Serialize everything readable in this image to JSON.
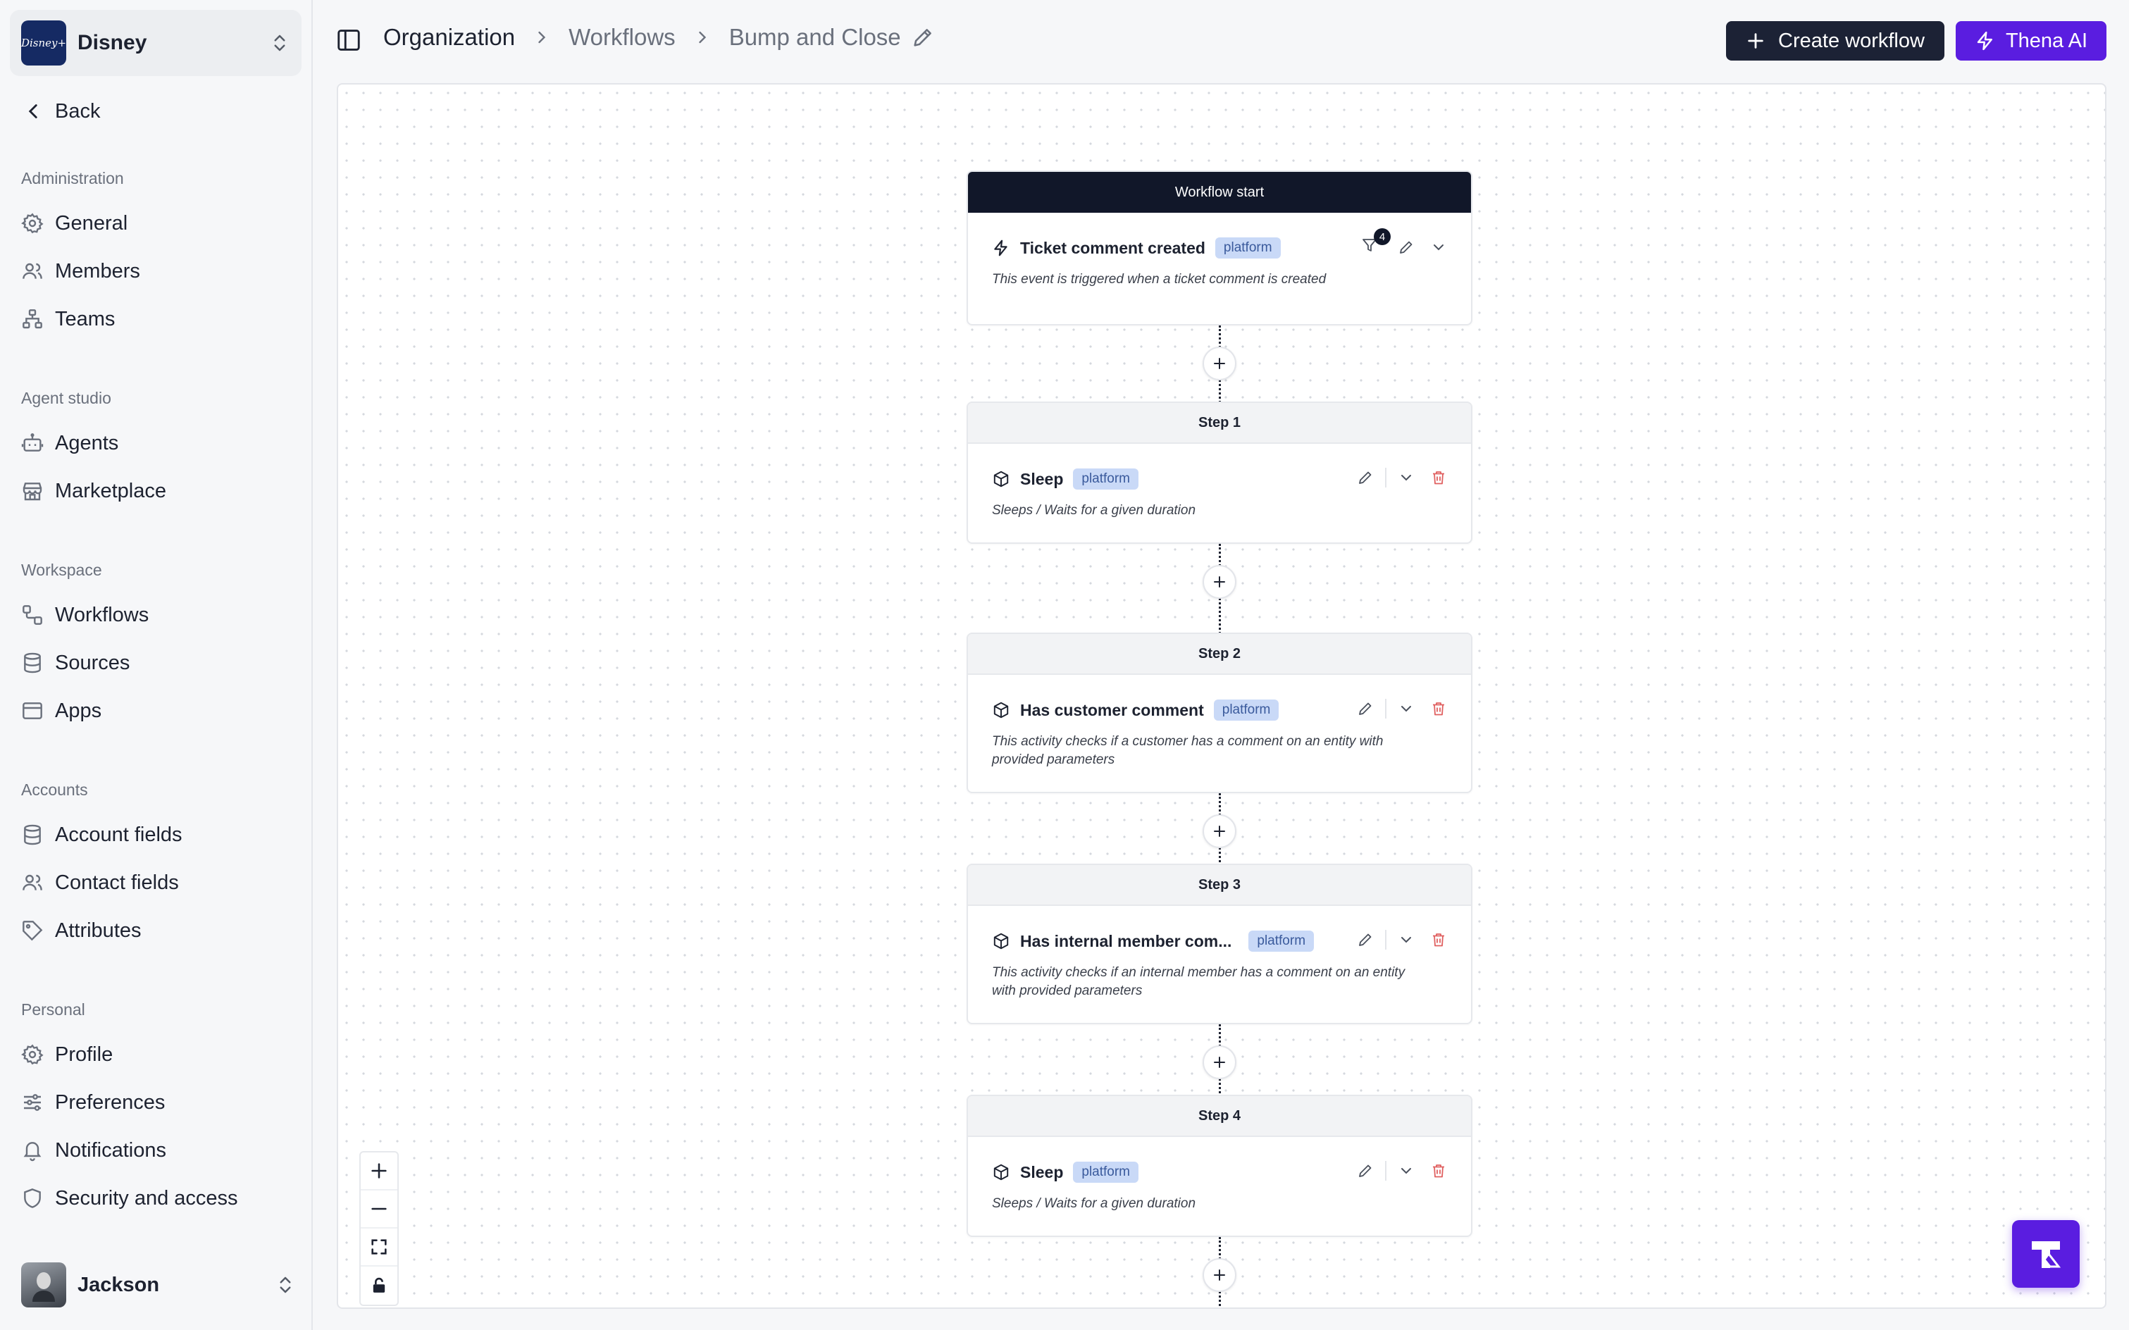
{
  "org": {
    "name": "Disney",
    "logo_text": "Disney+"
  },
  "nav": {
    "back_label": "Back",
    "sections": {
      "administration": {
        "label": "Administration",
        "items": [
          "General",
          "Members",
          "Teams"
        ]
      },
      "agent_studio": {
        "label": "Agent studio",
        "items": [
          "Agents",
          "Marketplace"
        ]
      },
      "workspace": {
        "label": "Workspace",
        "items": [
          "Workflows",
          "Sources",
          "Apps"
        ]
      },
      "accounts": {
        "label": "Accounts",
        "items": [
          "Account fields",
          "Contact fields",
          "Attributes"
        ]
      },
      "personal": {
        "label": "Personal",
        "items": [
          "Profile",
          "Preferences",
          "Notifications",
          "Security and access"
        ]
      }
    }
  },
  "user": {
    "name": "Jackson"
  },
  "breadcrumb": {
    "items": [
      "Organization",
      "Workflows",
      "Bump and Close"
    ]
  },
  "toolbar": {
    "create_label": "Create workflow",
    "ai_label": "Thena AI"
  },
  "workflow": {
    "start": {
      "header": "Workflow start",
      "title": "Ticket comment created",
      "tag": "platform",
      "filter_count": "4",
      "description": "This event is triggered when a ticket comment is created"
    },
    "steps": [
      {
        "header": "Step 1",
        "title": "Sleep",
        "tag": "platform",
        "description": "Sleeps / Waits for a given duration"
      },
      {
        "header": "Step 2",
        "title": "Has customer comment",
        "tag": "platform",
        "description": "This activity checks if a customer has a comment on an entity with provided parameters"
      },
      {
        "header": "Step 3",
        "title": "Has internal member com...",
        "tag": "platform",
        "description": "This activity checks if an internal member has a comment on an entity with provided parameters"
      },
      {
        "header": "Step 4",
        "title": "Sleep",
        "tag": "platform",
        "description": "Sleeps / Waits for a given duration"
      }
    ]
  },
  "colors": {
    "primary_dark": "#1c2235",
    "accent_purple": "#5a1de0",
    "tag_bg": "#c9d9f7",
    "danger": "#e06060"
  }
}
